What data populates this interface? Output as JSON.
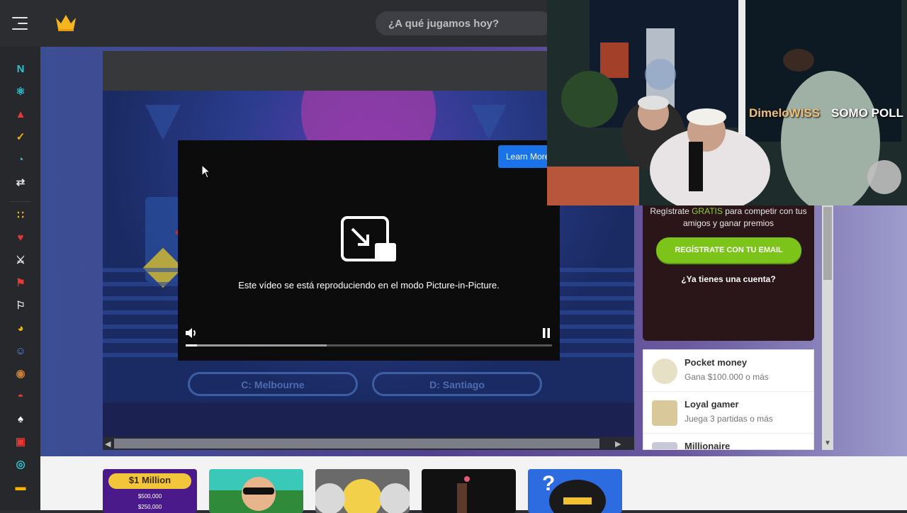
{
  "topbar": {
    "menu_icon": "hamburger-menu-icon",
    "logo_icon": "crown-icon",
    "search_placeholder": "¿A qué jugamos hoy?"
  },
  "sidebar": {
    "items": [
      {
        "icon": "new-badge-icon",
        "color": "#2ec4d6"
      },
      {
        "icon": "atom-icon",
        "color": "#2ec4d6"
      },
      {
        "icon": "flame-icon",
        "color": "#e53935"
      },
      {
        "icon": "check-badge-icon",
        "color": "#f4b400"
      },
      {
        "icon": "speedometer-icon",
        "color": "#2ec4d6"
      },
      {
        "icon": "shuffle-icon",
        "color": "#e6e6e6"
      },
      {
        "icon": "dots-grid-icon",
        "color": "#f4b400"
      },
      {
        "icon": "couple-icon",
        "color": "#e53935"
      },
      {
        "icon": "crossed-swords-icon",
        "color": "#e6e6e6"
      },
      {
        "icon": "flag-icon",
        "color": "#e53935"
      },
      {
        "icon": "checkered-flag-icon",
        "color": "#e6e6e6"
      },
      {
        "icon": "pacman-icon",
        "color": "#f4b400"
      },
      {
        "icon": "kids-icon",
        "color": "#5b8def"
      },
      {
        "icon": "teddy-bear-icon",
        "color": "#c67c3b"
      },
      {
        "icon": "pokeball-icon",
        "color": "#e53935"
      },
      {
        "icon": "spade-icon",
        "color": "#ffffff"
      },
      {
        "icon": "cards-icon",
        "color": "#e53935"
      },
      {
        "icon": "globe-icon",
        "color": "#2ec4d6"
      },
      {
        "icon": "car-icon",
        "color": "#f4b400"
      }
    ]
  },
  "game": {
    "pip_message": "Este vídeo se está reproduciendo en el modo Picture-in-Picture.",
    "learn_more": "Learn More",
    "progress": {
      "buffered": 0.385,
      "played": 0.03
    },
    "blurred_answers": [
      "C: Melbourne",
      "D: Santiago"
    ]
  },
  "stream": {
    "username": "DimeloWISS",
    "message": "SOMO POLL"
  },
  "register": {
    "text_before": "Regístrate ",
    "text_highlight": "GRATIS",
    "text_after": " para competir con tus amigos y ganar premios",
    "button": "REGÍSTRATE CON TU EMAIL",
    "login_link": "¿Ya tienes una cuenta?"
  },
  "achievements": [
    {
      "title": "Pocket money",
      "subtitle": "Gana $100.000 o más",
      "icon": "coin-icon"
    },
    {
      "title": "Loyal gamer",
      "subtitle": "Juega 3 partidas o más",
      "icon": "gamer-avatar-icon"
    },
    {
      "title": "Millionaire",
      "subtitle": "",
      "icon": "millionaire-icon"
    }
  ],
  "bottom_cards": [
    {
      "title": "$1 Million",
      "lines": [
        "$500,000",
        "$250,000"
      ],
      "color": "#4a1a8a"
    },
    {
      "title": "",
      "lines": [],
      "color": "#3ac8b8"
    },
    {
      "title": "",
      "lines": [],
      "color": "#6a6a6a"
    },
    {
      "title": "",
      "lines": [],
      "color": "#111111"
    },
    {
      "title": "",
      "lines": [],
      "color": "#2d6be0"
    }
  ]
}
